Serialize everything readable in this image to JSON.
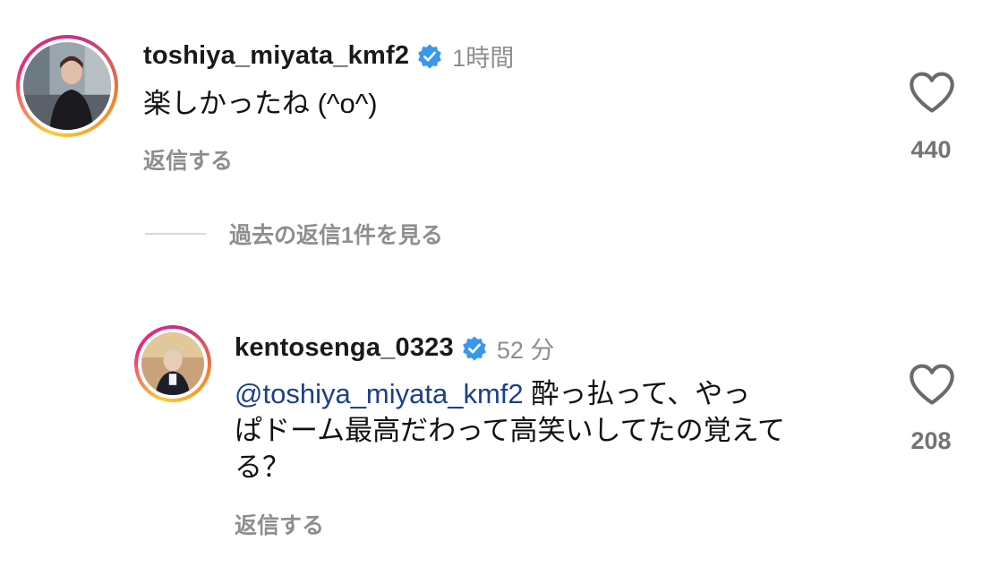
{
  "comments": [
    {
      "username": "toshiya_miyata_kmf2",
      "verified": true,
      "timestamp": "1時間",
      "text": "楽しかったね (^o^)",
      "reply_label": "返信する",
      "likes": "440",
      "avatar_icon": "user-avatar-photo"
    },
    {
      "username": "kentosenga_0323",
      "verified": true,
      "timestamp": "52 分",
      "mention": "@toshiya_miyata_kmf2",
      "text_line1": " 酔っ払って、やっ",
      "text_line2": "ぱドーム最高だわって高笑いしてたの覚えて",
      "text_line3": "る？",
      "reply_label": "返信する",
      "likes": "208",
      "avatar_icon": "user-avatar-photo"
    }
  ],
  "view_replies": {
    "label": "過去の返信1件を見る"
  },
  "colors": {
    "verified": "#3897f0",
    "mention": "#1d3f8a",
    "muted": "#8e8e8e"
  },
  "icons": {
    "verified": "verified-badge-icon",
    "like": "heart-outline-icon"
  }
}
